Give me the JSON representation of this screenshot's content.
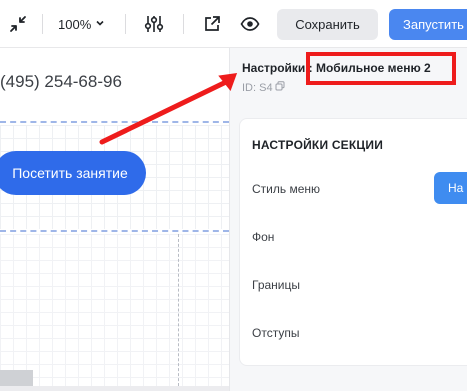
{
  "toolbar": {
    "zoom_value": "100%",
    "save_label": "Сохранить",
    "run_label": "Запустить",
    "icons": {
      "collapse": "collapse-arrows-icon",
      "settings": "sliders-icon",
      "external": "external-link-icon",
      "preview": "eye-icon"
    }
  },
  "canvas": {
    "phone_text": "(495) 254-68-96",
    "visit_button_label": "Посетить занятие"
  },
  "panel": {
    "title": "Настройки : Мобильное меню 2",
    "id_text": "ID: S4",
    "section_title": "НАСТРОЙКИ СЕКЦИИ",
    "rows": [
      {
        "label": "Стиль меню"
      },
      {
        "label": "Фон"
      },
      {
        "label": "Границы"
      },
      {
        "label": "Отступы"
      }
    ],
    "style_button_label": "На"
  },
  "colors": {
    "accent_blue": "#4a87f0",
    "visit_button_blue": "#2f6bea",
    "annotation_red": "#ee1c1c"
  }
}
